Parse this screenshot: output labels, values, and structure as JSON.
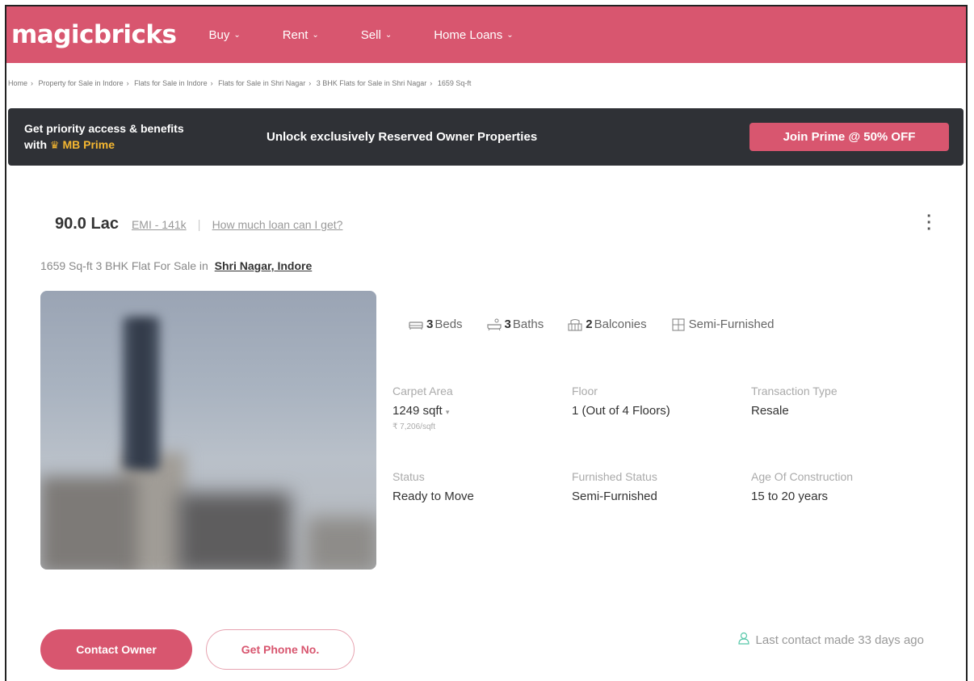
{
  "header": {
    "logo": "magicbricks",
    "nav": [
      {
        "label": "Buy"
      },
      {
        "label": "Rent"
      },
      {
        "label": "Sell"
      },
      {
        "label": "Home Loans"
      }
    ]
  },
  "breadcrumb": [
    "Home",
    "Property for Sale in Indore",
    "Flats for Sale in Indore",
    "Flats for Sale in Shri Nagar",
    "3 BHK Flats for Sale in Shri Nagar",
    "1659 Sq-ft"
  ],
  "banner": {
    "line1": "Get priority access & benefits",
    "line2_prefix": "with",
    "prime": "MB Prime",
    "headline": "Unlock exclusively Reserved Owner Properties",
    "cta": "Join Prime @ 50% OFF"
  },
  "listing": {
    "price": "90.0 Lac",
    "emi": "EMI - 141k",
    "loan_link": "How much loan can I get?",
    "subtitle": "1659 Sq-ft 3 BHK Flat For Sale in",
    "locality": "Shri Nagar, Indore",
    "amenities": {
      "beds_count": "3",
      "beds_label": "Beds",
      "baths_count": "3",
      "baths_label": "Baths",
      "balconies_count": "2",
      "balconies_label": "Balconies",
      "furnishing": "Semi-Furnished"
    },
    "details": {
      "carpet_area_label": "Carpet Area",
      "carpet_area_value": "1249 sqft",
      "price_per_sqft": "₹ 7,206/sqft",
      "floor_label": "Floor",
      "floor_value": "1 (Out of 4 Floors)",
      "transaction_label": "Transaction Type",
      "transaction_value": "Resale",
      "status_label": "Status",
      "status_value": "Ready to Move",
      "furnished_label": "Furnished Status",
      "furnished_value": "Semi-Furnished",
      "age_label": "Age Of Construction",
      "age_value": "15 to 20 years"
    }
  },
  "actions": {
    "contact_owner": "Contact Owner",
    "get_phone": "Get Phone No.",
    "last_contact": "Last contact made 33 days ago"
  },
  "colors": {
    "brand": "#d8566f",
    "banner_bg": "#2f3136",
    "prime_gold": "#f5b731",
    "contact_icon": "#56c7a9"
  }
}
